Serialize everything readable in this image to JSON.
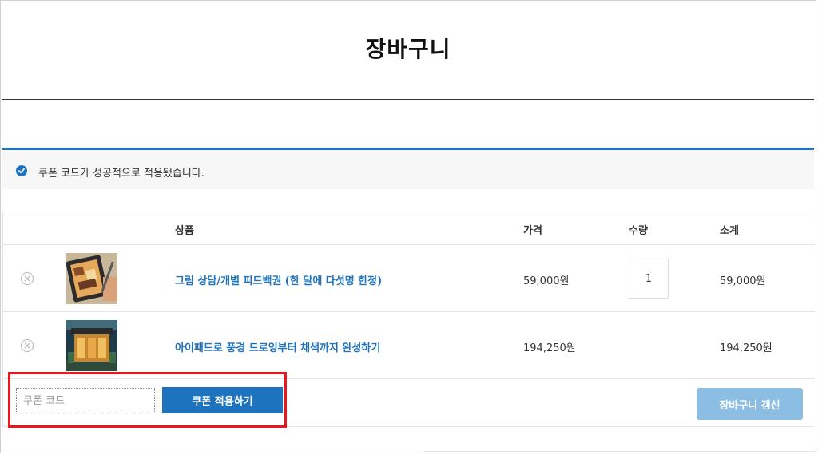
{
  "page": {
    "title": "장바구니"
  },
  "notice": {
    "message": "쿠폰 코드가 성공적으로 적용됐습니다."
  },
  "table": {
    "headers": {
      "product": "상품",
      "price": "가격",
      "quantity": "수량",
      "subtotal": "소계"
    },
    "rows": [
      {
        "name": "그림 상담/개별 피드백권 (한 달에 다섯명 한정)",
        "price": "59,000원",
        "quantity": "1",
        "subtotal": "59,000원"
      },
      {
        "name": "아이패드로 풍경 드로잉부터 채색까지 완성하기",
        "price": "194,250원",
        "quantity": "",
        "subtotal": "194,250원"
      }
    ]
  },
  "coupon": {
    "placeholder": "쿠폰 코드",
    "value": "",
    "apply_label": "쿠폰 적용하기"
  },
  "cart": {
    "update_label": "장바구니 갱신"
  },
  "colors": {
    "accent": "#1e73be",
    "accent_disabled": "#8cbde3",
    "highlight": "#e8191c"
  }
}
